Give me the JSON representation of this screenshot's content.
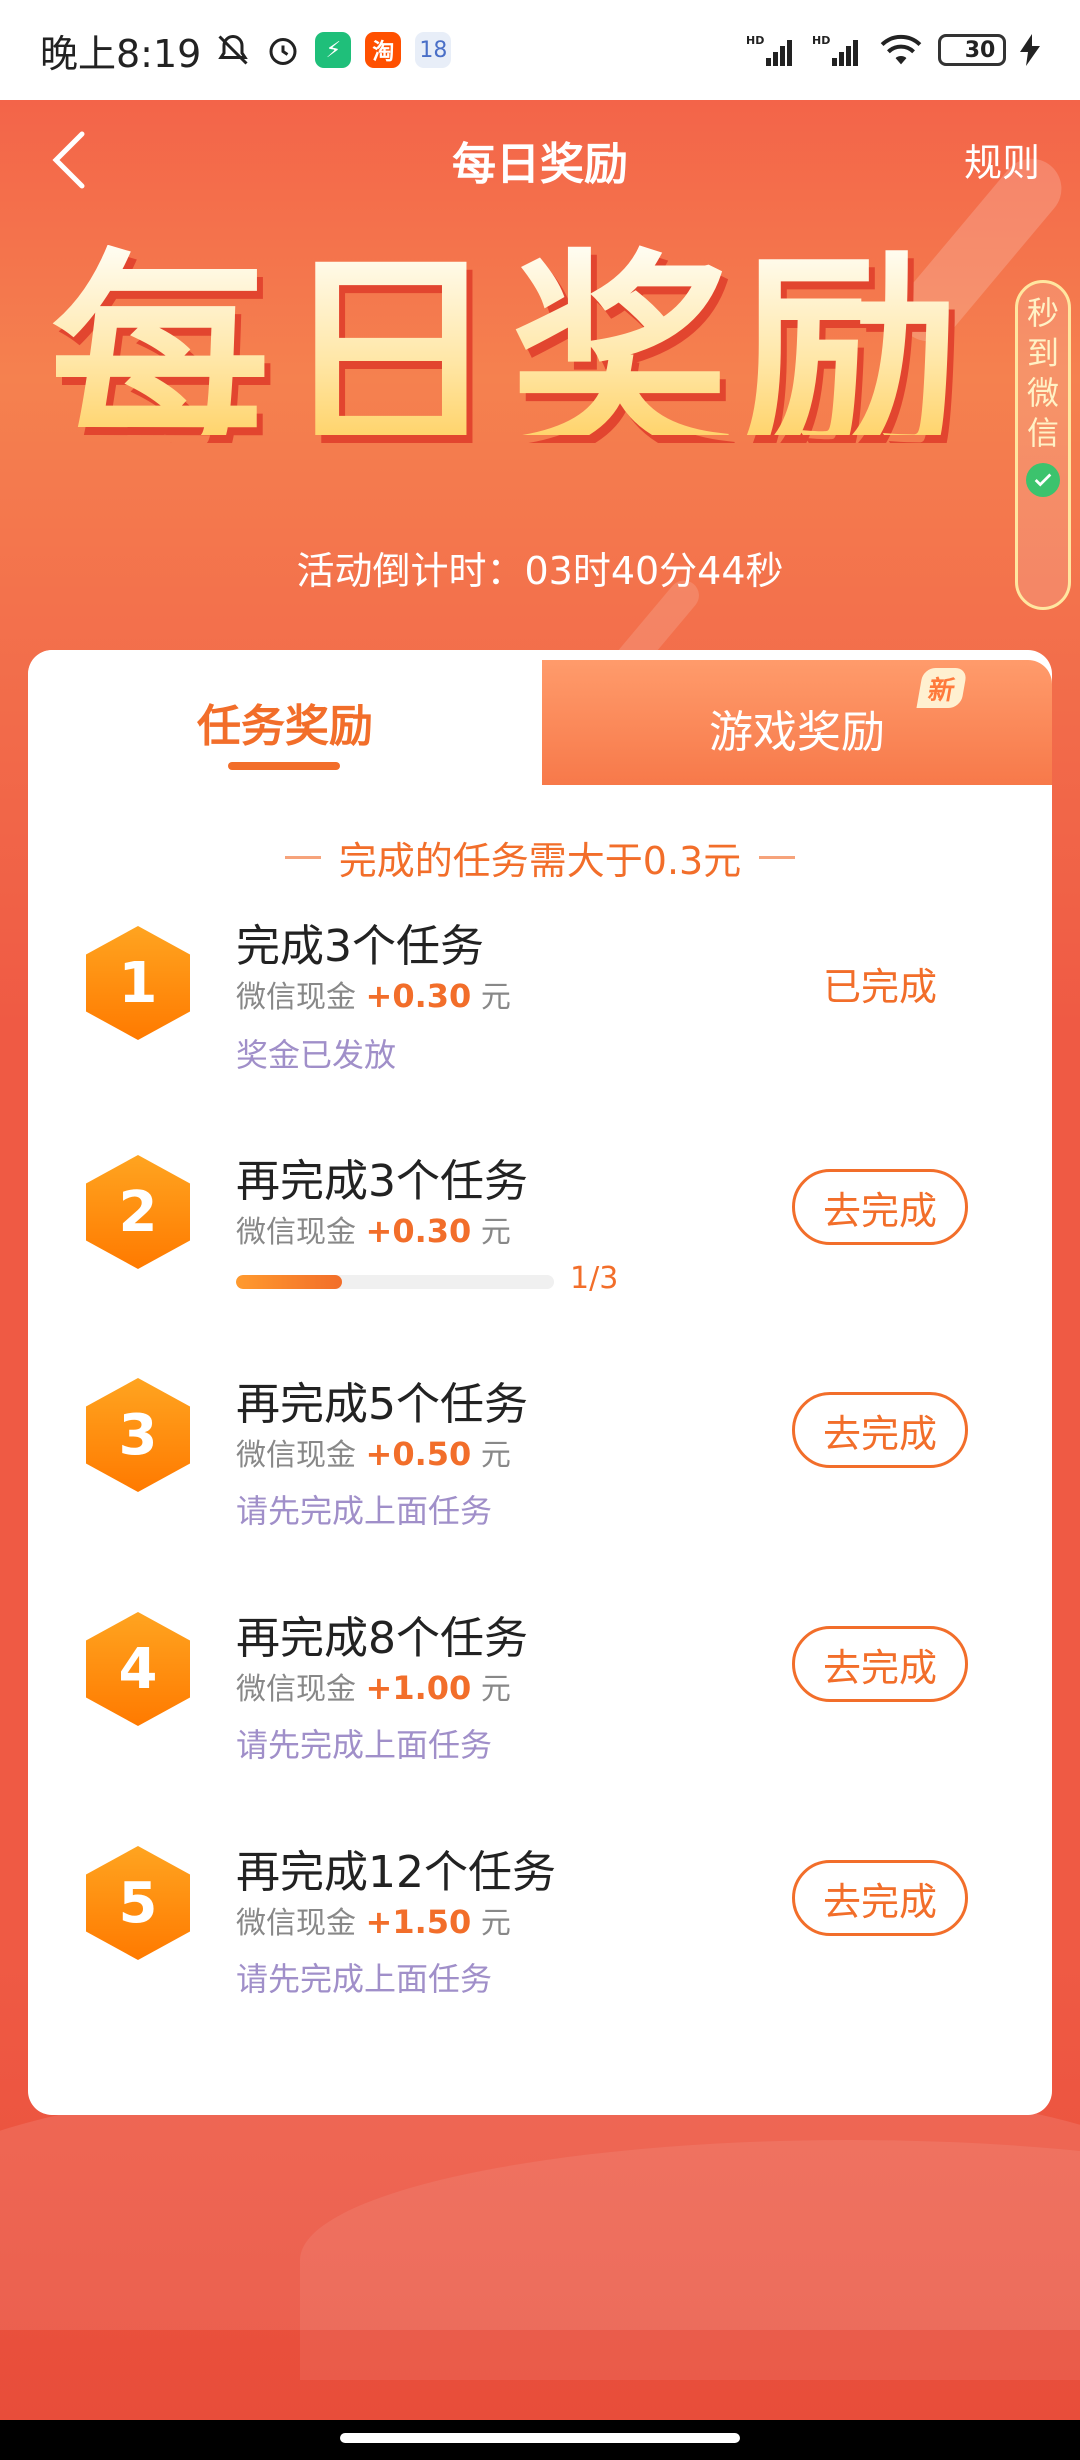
{
  "status_bar": {
    "time": "晚上8:19",
    "calendar_day": "18",
    "shop_icon_text": "淘",
    "battery": "30"
  },
  "nav": {
    "title": "每日奖励",
    "rules": "规则"
  },
  "hero": {
    "big_title": "每日奖励",
    "side_badge": [
      "秒",
      "到",
      "微",
      "信"
    ],
    "countdown_label": "活动倒计时：",
    "countdown_value": "03时40分44秒"
  },
  "tabs": [
    {
      "label": "任务奖励",
      "active": true
    },
    {
      "label": "游戏奖励",
      "active": false,
      "badge": "新"
    }
  ],
  "requirement": "完成的任务需大于0.3元",
  "reward_label": "微信现金",
  "unit": "元",
  "tasks": [
    {
      "number": "1",
      "title": "完成3个任务",
      "amount": "+0.30",
      "status": "已完成",
      "note": "奖金已发放"
    },
    {
      "number": "2",
      "title": "再完成3个任务",
      "amount": "+0.30",
      "button": "去完成",
      "progress": "1/3",
      "progress_fraction": 0.3333
    },
    {
      "number": "3",
      "title": "再完成5个任务",
      "amount": "+0.50",
      "button": "去完成",
      "note": "请先完成上面任务"
    },
    {
      "number": "4",
      "title": "再完成8个任务",
      "amount": "+1.00",
      "button": "去完成",
      "note": "请先完成上面任务"
    },
    {
      "number": "5",
      "title": "再完成12个任务",
      "amount": "+1.50",
      "button": "去完成",
      "note": "请先完成上面任务"
    }
  ],
  "colors": {
    "accent": "#f26e2a",
    "hero_bg": "#ef5a44",
    "note_purple": "#a08fc9"
  }
}
